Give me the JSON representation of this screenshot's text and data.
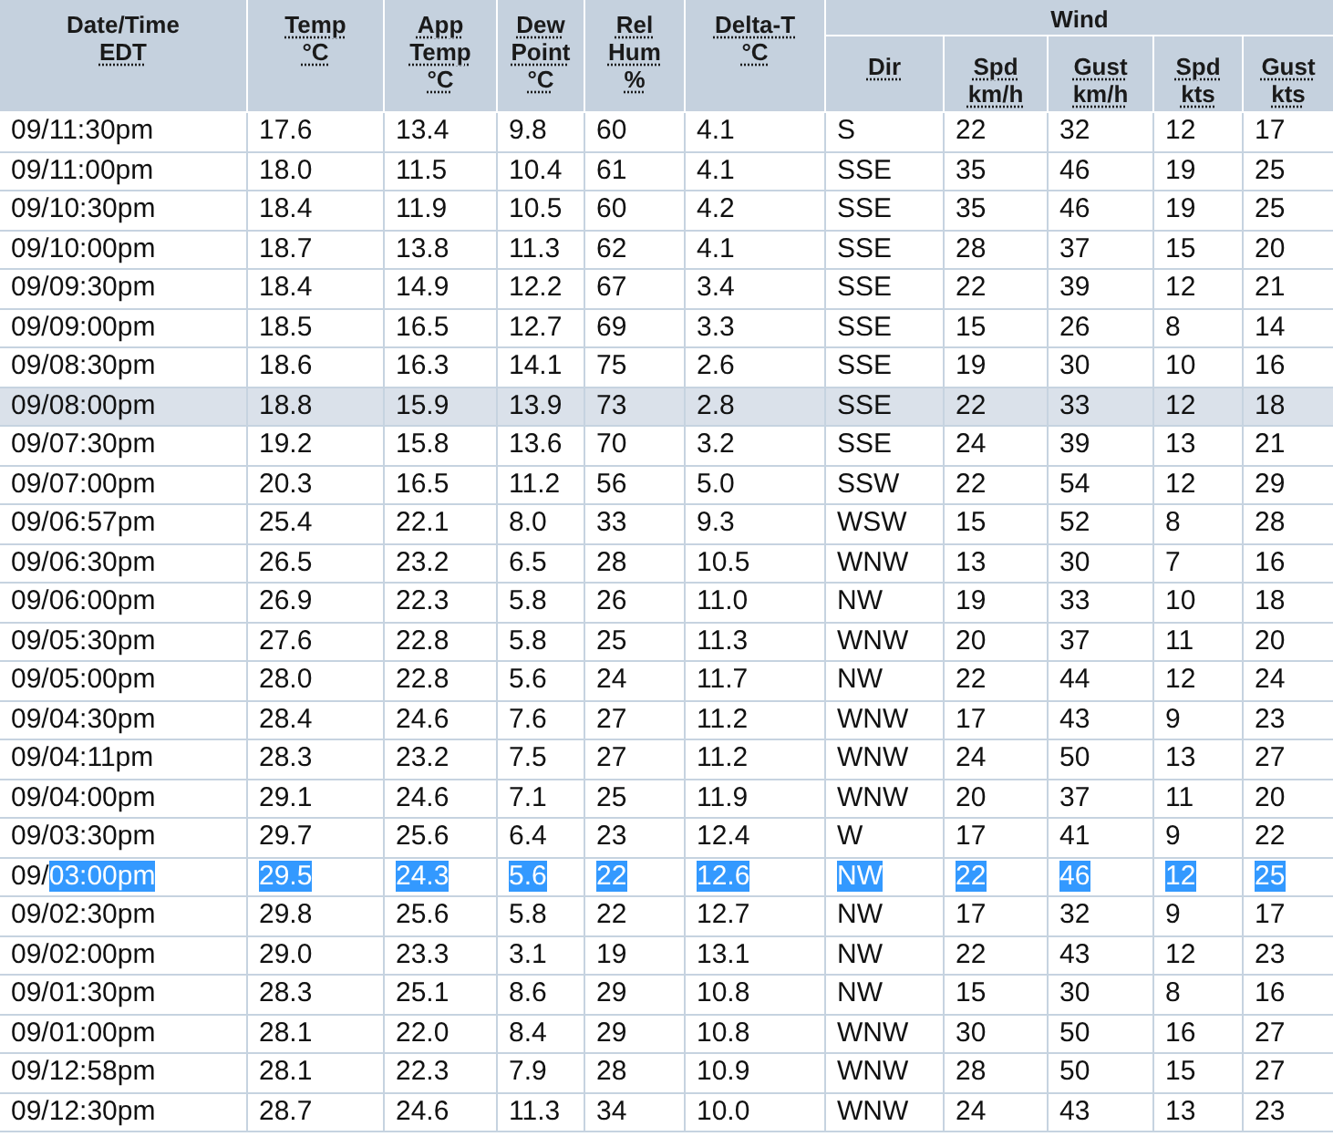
{
  "table": {
    "columns": [
      {
        "label": [
          "Date/Time",
          "EDT"
        ]
      },
      {
        "label": [
          "Temp",
          "°C"
        ]
      },
      {
        "label": [
          "App",
          "Temp",
          "°C"
        ]
      },
      {
        "label": [
          "Dew",
          "Point",
          "°C"
        ]
      },
      {
        "label": [
          "Rel",
          "Hum",
          "%"
        ]
      },
      {
        "label": [
          "Delta-T",
          "°C"
        ]
      },
      {
        "group": "Wind",
        "colspan": 5,
        "columns": [
          {
            "label": [
              "Dir"
            ]
          },
          {
            "label": [
              "Spd",
              "km/h"
            ]
          },
          {
            "label": [
              "Gust",
              "km/h"
            ]
          },
          {
            "label": [
              "Spd",
              "kts"
            ]
          },
          {
            "label": [
              "Gust",
              "kts"
            ]
          }
        ]
      }
    ],
    "rows": [
      {
        "cells": [
          [
            "09/",
            "11:30pm"
          ],
          "17.6",
          "13.4",
          "9.8",
          "60",
          "4.1",
          "S",
          "22",
          "32",
          "12",
          "17"
        ],
        "hovered": false,
        "selected": false
      },
      {
        "cells": [
          [
            "09/",
            "11:00pm"
          ],
          "18.0",
          "11.5",
          "10.4",
          "61",
          "4.1",
          "SSE",
          "35",
          "46",
          "19",
          "25"
        ],
        "hovered": false,
        "selected": false
      },
      {
        "cells": [
          [
            "09/",
            "10:30pm"
          ],
          "18.4",
          "11.9",
          "10.5",
          "60",
          "4.2",
          "SSE",
          "35",
          "46",
          "19",
          "25"
        ],
        "hovered": false,
        "selected": false
      },
      {
        "cells": [
          [
            "09/",
            "10:00pm"
          ],
          "18.7",
          "13.8",
          "11.3",
          "62",
          "4.1",
          "SSE",
          "28",
          "37",
          "15",
          "20"
        ],
        "hovered": false,
        "selected": false
      },
      {
        "cells": [
          [
            "09/",
            "09:30pm"
          ],
          "18.4",
          "14.9",
          "12.2",
          "67",
          "3.4",
          "SSE",
          "22",
          "39",
          "12",
          "21"
        ],
        "hovered": false,
        "selected": false
      },
      {
        "cells": [
          [
            "09/",
            "09:00pm"
          ],
          "18.5",
          "16.5",
          "12.7",
          "69",
          "3.3",
          "SSE",
          "15",
          "26",
          "8",
          "14"
        ],
        "hovered": false,
        "selected": false
      },
      {
        "cells": [
          [
            "09/",
            "08:30pm"
          ],
          "18.6",
          "16.3",
          "14.1",
          "75",
          "2.6",
          "SSE",
          "19",
          "30",
          "10",
          "16"
        ],
        "hovered": false,
        "selected": false
      },
      {
        "cells": [
          [
            "09/",
            "08:00pm"
          ],
          "18.8",
          "15.9",
          "13.9",
          "73",
          "2.8",
          "SSE",
          "22",
          "33",
          "12",
          "18"
        ],
        "hovered": true,
        "selected": false
      },
      {
        "cells": [
          [
            "09/",
            "07:30pm"
          ],
          "19.2",
          "15.8",
          "13.6",
          "70",
          "3.2",
          "SSE",
          "24",
          "39",
          "13",
          "21"
        ],
        "hovered": false,
        "selected": false
      },
      {
        "cells": [
          [
            "09/",
            "07:00pm"
          ],
          "20.3",
          "16.5",
          "11.2",
          "56",
          "5.0",
          "SSW",
          "22",
          "54",
          "12",
          "29"
        ],
        "hovered": false,
        "selected": false
      },
      {
        "cells": [
          [
            "09/",
            "06:57pm"
          ],
          "25.4",
          "22.1",
          "8.0",
          "33",
          "9.3",
          "WSW",
          "15",
          "52",
          "8",
          "28"
        ],
        "hovered": false,
        "selected": false
      },
      {
        "cells": [
          [
            "09/",
            "06:30pm"
          ],
          "26.5",
          "23.2",
          "6.5",
          "28",
          "10.5",
          "WNW",
          "13",
          "30",
          "7",
          "16"
        ],
        "hovered": false,
        "selected": false
      },
      {
        "cells": [
          [
            "09/",
            "06:00pm"
          ],
          "26.9",
          "22.3",
          "5.8",
          "26",
          "11.0",
          "NW",
          "19",
          "33",
          "10",
          "18"
        ],
        "hovered": false,
        "selected": false
      },
      {
        "cells": [
          [
            "09/",
            "05:30pm"
          ],
          "27.6",
          "22.8",
          "5.8",
          "25",
          "11.3",
          "WNW",
          "20",
          "37",
          "11",
          "20"
        ],
        "hovered": false,
        "selected": false
      },
      {
        "cells": [
          [
            "09/",
            "05:00pm"
          ],
          "28.0",
          "22.8",
          "5.6",
          "24",
          "11.7",
          "NW",
          "22",
          "44",
          "12",
          "24"
        ],
        "hovered": false,
        "selected": false
      },
      {
        "cells": [
          [
            "09/",
            "04:30pm"
          ],
          "28.4",
          "24.6",
          "7.6",
          "27",
          "11.2",
          "WNW",
          "17",
          "43",
          "9",
          "23"
        ],
        "hovered": false,
        "selected": false
      },
      {
        "cells": [
          [
            "09/",
            "04:11pm"
          ],
          "28.3",
          "23.2",
          "7.5",
          "27",
          "11.2",
          "WNW",
          "24",
          "50",
          "13",
          "27"
        ],
        "hovered": false,
        "selected": false
      },
      {
        "cells": [
          [
            "09/",
            "04:00pm"
          ],
          "29.1",
          "24.6",
          "7.1",
          "25",
          "11.9",
          "WNW",
          "20",
          "37",
          "11",
          "20"
        ],
        "hovered": false,
        "selected": false
      },
      {
        "cells": [
          [
            "09/",
            "03:30pm"
          ],
          "29.7",
          "25.6",
          "6.4",
          "23",
          "12.4",
          "W",
          "17",
          "41",
          "9",
          "22"
        ],
        "hovered": false,
        "selected": false
      },
      {
        "cells": [
          [
            "09/",
            "03:00pm"
          ],
          "29.5",
          "24.3",
          "5.6",
          "22",
          "12.6",
          "NW",
          "22",
          "46",
          "12",
          "25"
        ],
        "hovered": false,
        "selected": true
      },
      {
        "cells": [
          [
            "09/",
            "02:30pm"
          ],
          "29.8",
          "25.6",
          "5.8",
          "22",
          "12.7",
          "NW",
          "17",
          "32",
          "9",
          "17"
        ],
        "hovered": false,
        "selected": false
      },
      {
        "cells": [
          [
            "09/",
            "02:00pm"
          ],
          "29.0",
          "23.3",
          "3.1",
          "19",
          "13.1",
          "NW",
          "22",
          "43",
          "12",
          "23"
        ],
        "hovered": false,
        "selected": false
      },
      {
        "cells": [
          [
            "09/",
            "01:30pm"
          ],
          "28.3",
          "25.1",
          "8.6",
          "29",
          "10.8",
          "NW",
          "15",
          "30",
          "8",
          "16"
        ],
        "hovered": false,
        "selected": false
      },
      {
        "cells": [
          [
            "09/",
            "01:00pm"
          ],
          "28.1",
          "22.0",
          "8.4",
          "29",
          "10.8",
          "WNW",
          "30",
          "50",
          "16",
          "27"
        ],
        "hovered": false,
        "selected": false
      },
      {
        "cells": [
          [
            "09/",
            "12:58pm"
          ],
          "28.1",
          "22.3",
          "7.9",
          "28",
          "10.9",
          "WNW",
          "28",
          "50",
          "15",
          "27"
        ],
        "hovered": false,
        "selected": false
      },
      {
        "cells": [
          [
            "09/",
            "12:30pm"
          ],
          "28.7",
          "24.6",
          "11.3",
          "34",
          "10.0",
          "WNW",
          "24",
          "43",
          "13",
          "23"
        ],
        "hovered": false,
        "selected": false
      }
    ]
  }
}
